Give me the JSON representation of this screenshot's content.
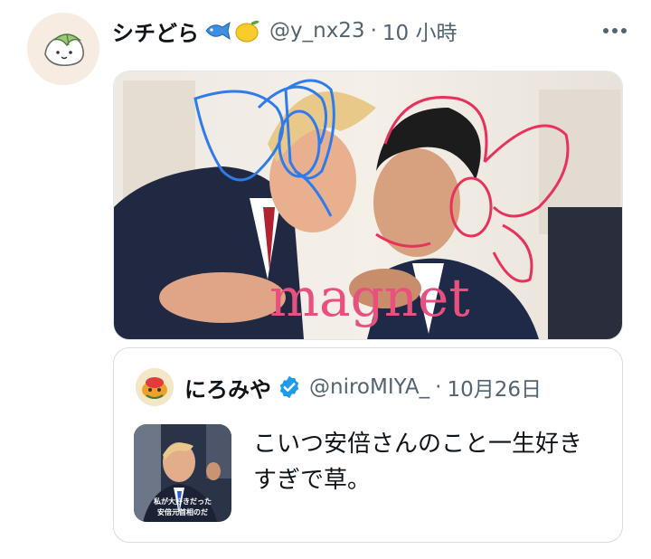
{
  "tweet": {
    "display_name": "シチどら",
    "name_emojis": [
      "fish-emoji",
      "lemon-emoji"
    ],
    "handle": "@y_nx23",
    "separator": "·",
    "time": "10 小時",
    "more_icon": "more-horizontal-icon",
    "media": {
      "caption_overlay": "magnet",
      "overlay_color": "#e8517d",
      "left_doodle_color": "#2f7bea",
      "right_doodle_color": "#e8315d"
    }
  },
  "quote": {
    "display_name": "にろみや",
    "verified_icon": "verified-badge-icon",
    "handle": "@niroMIYA_",
    "separator": "·",
    "date": "10月26日",
    "text": "こいつ安倍さんのこと一生好きすぎで草。",
    "thumbnail_caption_line1": "私が大好きだった",
    "thumbnail_caption_line2": "安倍元首相のだ"
  },
  "colors": {
    "verified": "#1d9bf0",
    "secondary_text": "#536471",
    "border": "#d6dde2"
  }
}
